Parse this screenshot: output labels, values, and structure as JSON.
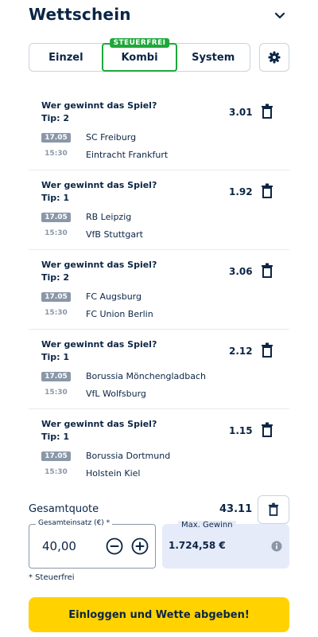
{
  "header": {
    "title": "Wettschein"
  },
  "tabs": [
    {
      "label": "Einzel"
    },
    {
      "label": "Kombi",
      "badge": "STEUERFREI",
      "active": true
    },
    {
      "label": "System"
    }
  ],
  "bets": [
    {
      "question": "Wer gewinnt das Spiel?",
      "tip": "Tip: 2",
      "odd": "3.01",
      "date": "17.05",
      "time": "15:30",
      "home": "SC Freiburg",
      "away": "Eintracht Frankfurt"
    },
    {
      "question": "Wer gewinnt das Spiel?",
      "tip": "Tip: 1",
      "odd": "1.92",
      "date": "17.05",
      "time": "15:30",
      "home": "RB Leipzig",
      "away": "VfB Stuttgart"
    },
    {
      "question": "Wer gewinnt das Spiel?",
      "tip": "Tip: 2",
      "odd": "3.06",
      "date": "17.05",
      "time": "15:30",
      "home": "FC Augsburg",
      "away": "FC Union Berlin"
    },
    {
      "question": "Wer gewinnt das Spiel?",
      "tip": "Tip: 1",
      "odd": "2.12",
      "date": "17.05",
      "time": "15:30",
      "home": "Borussia Mönchengladbach",
      "away": "VfL Wolfsburg"
    },
    {
      "question": "Wer gewinnt das Spiel?",
      "tip": "Tip: 1",
      "odd": "1.15",
      "date": "17.05",
      "time": "15:30",
      "home": "Borussia Dortmund",
      "away": "Holstein Kiel"
    }
  ],
  "total": {
    "label": "Gesamtquote",
    "value": "43.11"
  },
  "stake": {
    "legend": "Gesamteinsatz (€) *",
    "value": "40,00"
  },
  "win": {
    "legend": "Max. Gewinn",
    "value": "1.724,58 €"
  },
  "footnote": "* Steuerfrei",
  "cta": {
    "label": "Einloggen und Wette abgeben!"
  },
  "colors": {
    "primary": "#0b2545",
    "accent_green": "#1ea83a",
    "cta_yellow": "#ffd200",
    "muted": "#8a97a8",
    "win_bg": "#e6ebfa"
  },
  "icons": [
    "chevron-down-icon",
    "gear-icon",
    "trash-icon",
    "minus-circle-icon",
    "plus-circle-icon",
    "info-icon"
  ]
}
